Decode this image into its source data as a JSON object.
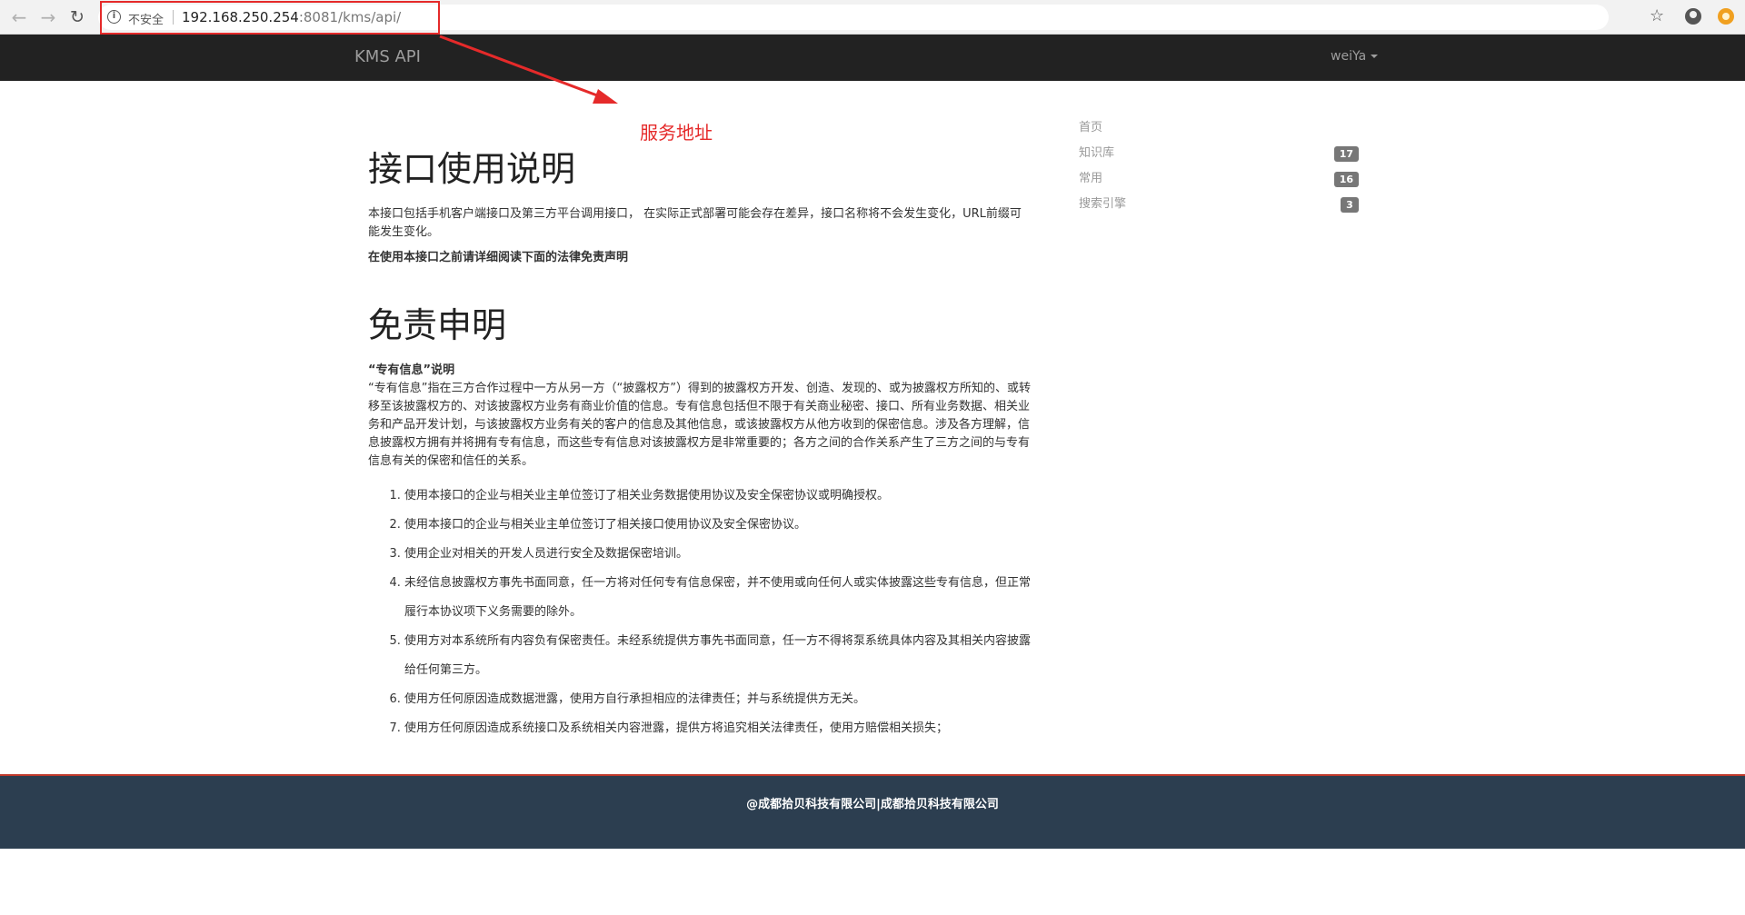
{
  "browser": {
    "security_label": "不安全",
    "url_host": "192.168.250.254",
    "url_rest": ":8081/kms/api/"
  },
  "annotation": {
    "label": "服务地址",
    "color": "#e52a2a"
  },
  "navbar": {
    "brand": "KMS API",
    "user": "weiYa"
  },
  "main": {
    "title_usage": "接口使用说明",
    "usage_text": "本接口包括手机客户端接口及第三方平台调用接口， 在实际正式部署可能会存在差异，接口名称将不会发生变化，URL前缀可能发生变化。",
    "usage_notice": "在使用本接口之前请详细阅读下面的法律免责声明",
    "title_disclaimer": "免责申明",
    "info_title": "“专有信息”说明",
    "info_body": "“专有信息”指在三方合作过程中一方从另一方（“披露权方”）得到的披露权方开发、创造、发现的、或为披露权方所知的、或转移至该披露权方的、对该披露权方业务有商业价值的信息。专有信息包括但不限于有关商业秘密、接口、所有业务数据、相关业务和产品开发计划，与该披露权方业务有关的客户的信息及其他信息，或该披露权方从他方收到的保密信息。涉及各方理解，信息披露权方拥有并将拥有专有信息，而这些专有信息对该披露权方是非常重要的；各方之间的合作关系产生了三方之间的与专有信息有关的保密和信任的关系。",
    "terms": [
      "使用本接口的企业与相关业主单位签订了相关业务数据使用协议及安全保密协议或明确授权。",
      "使用本接口的企业与相关业主单位签订了相关接口使用协议及安全保密协议。",
      "使用企业对相关的开发人员进行安全及数据保密培训。",
      "未经信息披露权方事先书面同意，任一方将对任何专有信息保密，并不使用或向任何人或实体披露这些专有信息，但正常履行本协议项下义务需要的除外。",
      "使用方对本系统所有内容负有保密责任。未经系统提供方事先书面同意，任一方不得将泵系统具体内容及其相关内容披露给任何第三方。",
      "使用方任何原因造成数据泄露，使用方自行承担相应的法律责任；并与系统提供方无关。",
      "使用方任何原因造成系统接口及系统相关内容泄露，提供方将追究相关法律责任，使用方赔偿相关损失；"
    ]
  },
  "sidebar": {
    "items": [
      {
        "label": "首页",
        "badge": ""
      },
      {
        "label": "知识库",
        "badge": "17"
      },
      {
        "label": "常用",
        "badge": "16"
      },
      {
        "label": "搜索引擎",
        "badge": "3"
      }
    ]
  },
  "footer": {
    "text": "@成都拾贝科技有限公司|成都拾贝科技有限公司"
  },
  "colors": {
    "navbar_bg": "#222222",
    "footer_bg": "#2c3e50",
    "footer_border": "#c0392b",
    "badge_bg": "#777777"
  }
}
